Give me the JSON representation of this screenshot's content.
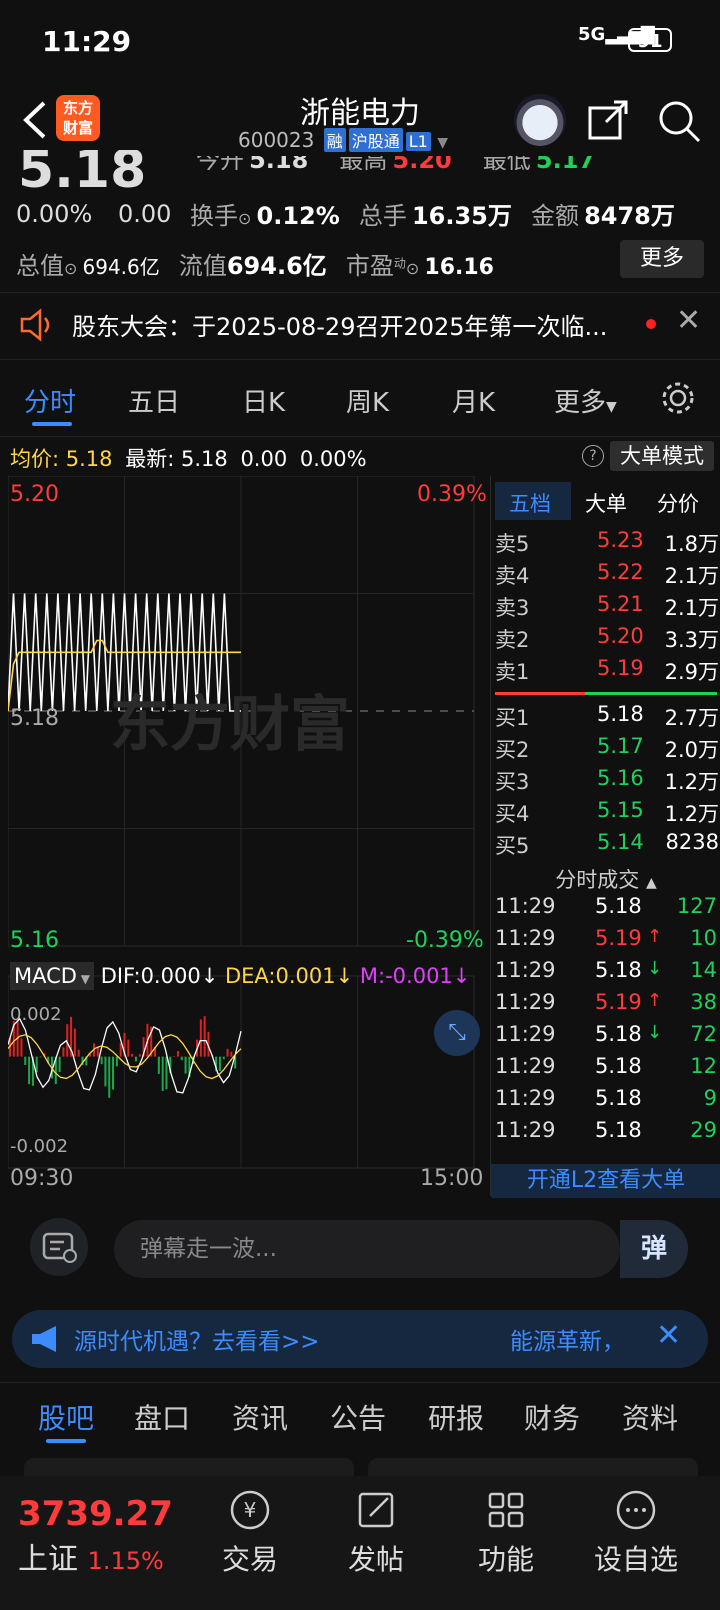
{
  "status": {
    "time": "11:29",
    "network": "5G",
    "battery": "91"
  },
  "header": {
    "logo_text": "东方\n财富",
    "stock_name": "浙能电力",
    "stock_code": "600023",
    "tags": [
      "融",
      "沪股通",
      "L1"
    ]
  },
  "quote": {
    "price": "5.18",
    "change_pct": "0.00%",
    "change_val": "0.00",
    "row0": [
      {
        "label": "今开",
        "value": "5.18",
        "color": "#dddddd"
      },
      {
        "label": "最高",
        "value": "5.20",
        "color": "#ff3b3b"
      },
      {
        "label": "最低",
        "value": "5.17",
        "color": "#1fd15b"
      }
    ],
    "turnover_label": "换手",
    "turnover": "0.12%",
    "volume_label": "总手",
    "volume": "16.35万",
    "amount_label": "金额",
    "amount": "8478万",
    "mktcap_label": "总值",
    "mktcap": "694.6亿",
    "float_label": "流值",
    "float": "694.6亿",
    "pe_label": "市盈",
    "pe_sup": "动",
    "pe": "16.16",
    "more": "更多"
  },
  "notice": {
    "text": "股东大会：于2025-08-29召开2025年第一次临..."
  },
  "chart_tabs": [
    "分时",
    "五日",
    "日K",
    "周K",
    "月K",
    "更多"
  ],
  "avg_bar": {
    "avg_label": "均价:",
    "avg": "5.18",
    "latest_label": "最新:",
    "latest": "5.18",
    "chg": "0.00",
    "pct": "0.00%",
    "mode_btn": "大单模式"
  },
  "chart_labels": {
    "y_top": "5.20",
    "y_top_pct": "0.39%",
    "y_mid": "5.18",
    "y_bottom": "5.16",
    "y_bottom_pct": "-0.39%",
    "watermark": "东方财富",
    "macd_label": "MACD",
    "dif": "DIF:0.000↓",
    "dea": "DEA:0.001↓",
    "m": "M:-0.001↓",
    "macd_top": "0.002",
    "macd_bottom": "-0.002",
    "x_start": "09:30",
    "x_end": "15:00"
  },
  "chart_data": {
    "type": "line",
    "title": "",
    "xlabel": "",
    "ylabel": "",
    "x_range": [
      "09:30",
      "15:00"
    ],
    "ylim": [
      5.16,
      5.2
    ],
    "reference": 5.18,
    "series": [
      {
        "name": "",
        "values": [
          5.18,
          5.19,
          5.18,
          5.19,
          5.18,
          5.19,
          5.18,
          5.19,
          5.18,
          5.19,
          5.18,
          5.19,
          5.18,
          5.19,
          5.18,
          5.19,
          5.18,
          5.19,
          5.18,
          5.19,
          5.18,
          5.19,
          5.18,
          5.19,
          5.18,
          5.19,
          5.18,
          5.19,
          5.18,
          5.19,
          5.18,
          5.19,
          5.18,
          5.19,
          5.18,
          5.19,
          5.18,
          5.19,
          5.18,
          5.19,
          5.18,
          5.18,
          5.18
        ]
      },
      {
        "name": "均价",
        "values": [
          5.18,
          5.184,
          5.185,
          5.185,
          5.185,
          5.185,
          5.185,
          5.185,
          5.185,
          5.185,
          5.185,
          5.185,
          5.185,
          5.185,
          5.185,
          5.185,
          5.186,
          5.186,
          5.185,
          5.185,
          5.185,
          5.185,
          5.185,
          5.185,
          5.185,
          5.185,
          5.185,
          5.185,
          5.185,
          5.185,
          5.185,
          5.185,
          5.185,
          5.185,
          5.185,
          5.185,
          5.185,
          5.185,
          5.185,
          5.185,
          5.185,
          5.185,
          5.185
        ]
      }
    ],
    "macd": {
      "ylim": [
        -0.002,
        0.002
      ],
      "dif_last": 0.0,
      "dea_last": 0.001,
      "m_last": -0.001
    }
  },
  "orderbook": {
    "tabs": [
      "五档",
      "大单",
      "分价"
    ],
    "asks": [
      {
        "label": "卖5",
        "price": "5.23",
        "vol": "1.8万"
      },
      {
        "label": "卖4",
        "price": "5.22",
        "vol": "2.1万"
      },
      {
        "label": "卖3",
        "price": "5.21",
        "vol": "2.1万"
      },
      {
        "label": "卖2",
        "price": "5.20",
        "vol": "3.3万"
      },
      {
        "label": "卖1",
        "price": "5.19",
        "vol": "2.9万"
      }
    ],
    "bids": [
      {
        "label": "买1",
        "price": "5.18",
        "vol": "2.7万"
      },
      {
        "label": "买2",
        "price": "5.17",
        "vol": "2.0万"
      },
      {
        "label": "买3",
        "price": "5.16",
        "vol": "1.2万"
      },
      {
        "label": "买4",
        "price": "5.15",
        "vol": "1.2万"
      },
      {
        "label": "买5",
        "price": "5.14",
        "vol": "8238"
      }
    ],
    "ticks_title": "分时成交",
    "ticks": [
      {
        "time": "11:29",
        "price": "5.18",
        "dir": "",
        "vol": "127",
        "pc": "#ffffff"
      },
      {
        "time": "11:29",
        "price": "5.19",
        "dir": "↑",
        "vol": "10",
        "pc": "#ff3b3b"
      },
      {
        "time": "11:29",
        "price": "5.18",
        "dir": "↓",
        "vol": "14",
        "pc": "#ffffff"
      },
      {
        "time": "11:29",
        "price": "5.19",
        "dir": "↑",
        "vol": "38",
        "pc": "#ff3b3b"
      },
      {
        "time": "11:29",
        "price": "5.18",
        "dir": "↓",
        "vol": "72",
        "pc": "#ffffff"
      },
      {
        "time": "11:29",
        "price": "5.18",
        "dir": "",
        "vol": "12",
        "pc": "#ffffff"
      },
      {
        "time": "11:29",
        "price": "5.18",
        "dir": "",
        "vol": "9",
        "pc": "#ffffff"
      },
      {
        "time": "11:29",
        "price": "5.18",
        "dir": "",
        "vol": "29",
        "pc": "#ffffff"
      }
    ],
    "l2_banner": "开通L2查看大单"
  },
  "danmu": {
    "placeholder": "弹幕走一波...",
    "btn": "弹"
  },
  "banner": {
    "text": "源时代机遇？去看看>>",
    "right": "能源革新，"
  },
  "bottom_tabs": [
    "股吧",
    "盘口",
    "资讯",
    "公告",
    "研报",
    "财务",
    "资料"
  ],
  "navbar": {
    "index_value": "3739.27",
    "index_name": "上证",
    "index_pct": "1.15%",
    "items": [
      "交易",
      "发帖",
      "功能",
      "设自选"
    ]
  },
  "colors": {
    "accent": "#3d8cff",
    "up": "#ff3b3b",
    "down": "#1fd15b",
    "avg": "#ffd54a",
    "brand": "#ff5a1f"
  }
}
